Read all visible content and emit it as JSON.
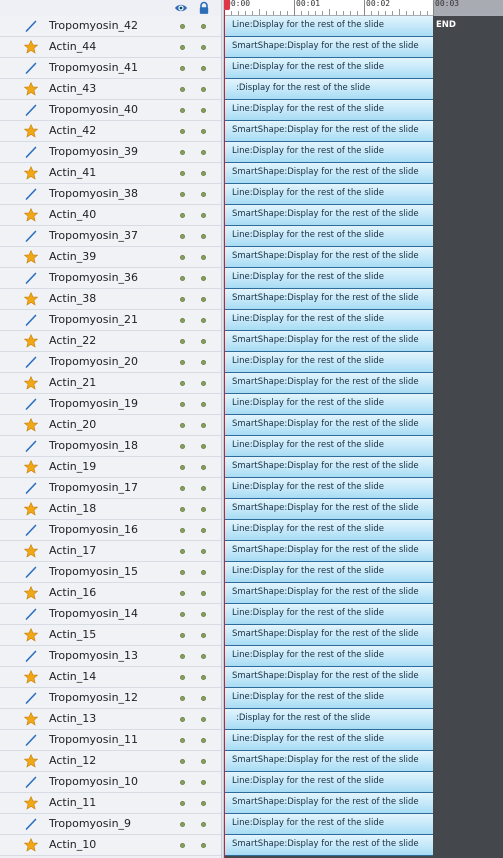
{
  "timeline": {
    "ruler_labels": [
      "00:00",
      "00:01",
      "00:02",
      "00:03"
    ],
    "end_label": "END"
  },
  "icons": {
    "visibility": "eye-icon",
    "lock": "lock-icon",
    "line_type": "line-icon",
    "star_type": "star-shape-icon",
    "status_dot": "green-dot-icon"
  },
  "colors": {
    "playhead": "#e0364a",
    "timeline_bg": "#44474c",
    "track_fill": "#c8eafa",
    "dot": "#8aa060",
    "line_icon": "#2a6fc0",
    "star_icon": "#f0a818"
  },
  "layers": [
    {
      "name": "Tropomyosin_42",
      "type": "line",
      "bar": "Line:Display for the rest of the slide"
    },
    {
      "name": "Actin_44",
      "type": "star",
      "bar": "SmartShape:Display for the rest of the slide"
    },
    {
      "name": "Tropomyosin_41",
      "type": "line",
      "bar": "Line:Display for the rest of the slide"
    },
    {
      "name": "Actin_43",
      "type": "star",
      "bar": ":Display for the rest of the slide"
    },
    {
      "name": "Tropomyosin_40",
      "type": "line",
      "bar": "Line:Display for the rest of the slide"
    },
    {
      "name": "Actin_42",
      "type": "star",
      "bar": "SmartShape:Display for the rest of the slide"
    },
    {
      "name": "Tropomyosin_39",
      "type": "line",
      "bar": "Line:Display for the rest of the slide"
    },
    {
      "name": "Actin_41",
      "type": "star",
      "bar": "SmartShape:Display for the rest of the slide"
    },
    {
      "name": "Tropomyosin_38",
      "type": "line",
      "bar": "Line:Display for the rest of the slide"
    },
    {
      "name": "Actin_40",
      "type": "star",
      "bar": "SmartShape:Display for the rest of the slide"
    },
    {
      "name": "Tropomyosin_37",
      "type": "line",
      "bar": "Line:Display for the rest of the slide"
    },
    {
      "name": "Actin_39",
      "type": "star",
      "bar": "SmartShape:Display for the rest of the slide"
    },
    {
      "name": "Tropomyosin_36",
      "type": "line",
      "bar": "Line:Display for the rest of the slide"
    },
    {
      "name": "Actin_38",
      "type": "star",
      "bar": "SmartShape:Display for the rest of the slide"
    },
    {
      "name": "Tropomyosin_21",
      "type": "line",
      "bar": "Line:Display for the rest of the slide"
    },
    {
      "name": "Actin_22",
      "type": "star",
      "bar": "SmartShape:Display for the rest of the slide"
    },
    {
      "name": "Tropomyosin_20",
      "type": "line",
      "bar": "Line:Display for the rest of the slide"
    },
    {
      "name": "Actin_21",
      "type": "star",
      "bar": "SmartShape:Display for the rest of the slide"
    },
    {
      "name": "Tropomyosin_19",
      "type": "line",
      "bar": "Line:Display for the rest of the slide"
    },
    {
      "name": "Actin_20",
      "type": "star",
      "bar": "SmartShape:Display for the rest of the slide"
    },
    {
      "name": "Tropomyosin_18",
      "type": "line",
      "bar": "Line:Display for the rest of the slide"
    },
    {
      "name": "Actin_19",
      "type": "star",
      "bar": "SmartShape:Display for the rest of the slide"
    },
    {
      "name": "Tropomyosin_17",
      "type": "line",
      "bar": "Line:Display for the rest of the slide"
    },
    {
      "name": "Actin_18",
      "type": "star",
      "bar": "SmartShape:Display for the rest of the slide"
    },
    {
      "name": "Tropomyosin_16",
      "type": "line",
      "bar": "Line:Display for the rest of the slide"
    },
    {
      "name": "Actin_17",
      "type": "star",
      "bar": "SmartShape:Display for the rest of the slide"
    },
    {
      "name": "Tropomyosin_15",
      "type": "line",
      "bar": "Line:Display for the rest of the slide"
    },
    {
      "name": "Actin_16",
      "type": "star",
      "bar": "SmartShape:Display for the rest of the slide"
    },
    {
      "name": "Tropomyosin_14",
      "type": "line",
      "bar": "Line:Display for the rest of the slide"
    },
    {
      "name": "Actin_15",
      "type": "star",
      "bar": "SmartShape:Display for the rest of the slide"
    },
    {
      "name": "Tropomyosin_13",
      "type": "line",
      "bar": "Line:Display for the rest of the slide"
    },
    {
      "name": "Actin_14",
      "type": "star",
      "bar": "SmartShape:Display for the rest of the slide"
    },
    {
      "name": "Tropomyosin_12",
      "type": "line",
      "bar": "Line:Display for the rest of the slide"
    },
    {
      "name": "Actin_13",
      "type": "star",
      "bar": ":Display for the rest of the slide"
    },
    {
      "name": "Tropomyosin_11",
      "type": "line",
      "bar": "Line:Display for the rest of the slide"
    },
    {
      "name": "Actin_12",
      "type": "star",
      "bar": "SmartShape:Display for the rest of the slide"
    },
    {
      "name": "Tropomyosin_10",
      "type": "line",
      "bar": "Line:Display for the rest of the slide"
    },
    {
      "name": "Actin_11",
      "type": "star",
      "bar": "SmartShape:Display for the rest of the slide"
    },
    {
      "name": "Tropomyosin_9",
      "type": "line",
      "bar": "Line:Display for the rest of the slide"
    },
    {
      "name": "Actin_10",
      "type": "star",
      "bar": "SmartShape:Display for the rest of the slide"
    }
  ]
}
